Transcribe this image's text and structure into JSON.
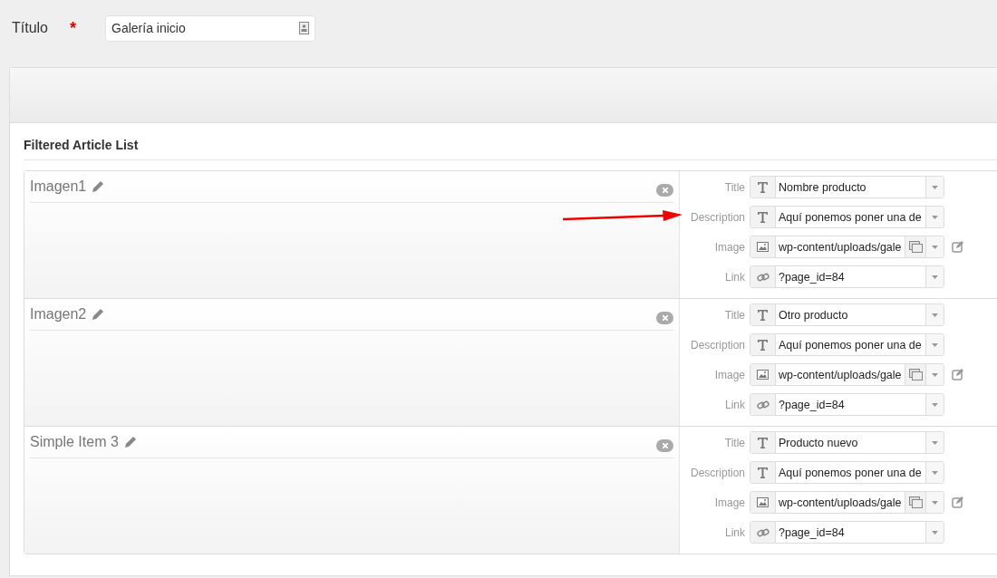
{
  "title_field": {
    "label": "Título",
    "required_mark": "*",
    "value": "Galería inicio"
  },
  "section": {
    "heading": "Filtered Article List"
  },
  "items": [
    {
      "name": "Imagen1",
      "annotated": true,
      "fields": [
        {
          "label": "Title",
          "kind": "text",
          "value": "Nombre producto"
        },
        {
          "label": "Description",
          "kind": "text",
          "value": "Aquí ponemos poner una de"
        },
        {
          "label": "Image",
          "kind": "image",
          "value": "wp-content/uploads/gale"
        },
        {
          "label": "Link",
          "kind": "link",
          "value": "?page_id=84"
        }
      ]
    },
    {
      "name": "Imagen2",
      "annotated": false,
      "fields": [
        {
          "label": "Title",
          "kind": "text",
          "value": "Otro producto"
        },
        {
          "label": "Description",
          "kind": "text",
          "value": "Aquí ponemos poner una de"
        },
        {
          "label": "Image",
          "kind": "image",
          "value": "wp-content/uploads/gale"
        },
        {
          "label": "Link",
          "kind": "link",
          "value": "?page_id=84"
        }
      ]
    },
    {
      "name": "Simple Item 3",
      "annotated": false,
      "fields": [
        {
          "label": "Title",
          "kind": "text",
          "value": "Producto nuevo"
        },
        {
          "label": "Description",
          "kind": "text",
          "value": "Aquí ponemos poner una de"
        },
        {
          "label": "Image",
          "kind": "image",
          "value": "wp-content/uploads/gale"
        },
        {
          "label": "Link",
          "kind": "link",
          "value": "?page_id=84"
        }
      ]
    }
  ]
}
